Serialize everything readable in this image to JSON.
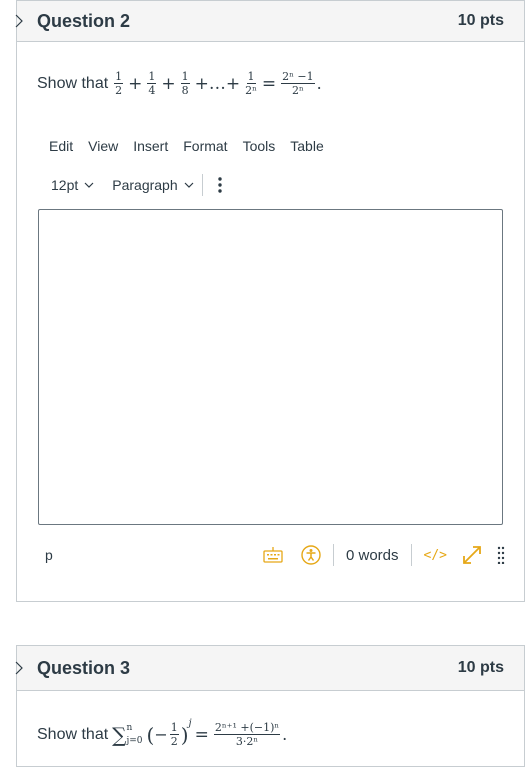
{
  "question2": {
    "title": "Question 2",
    "points": "10 pts",
    "prompt_prefix": "Show that",
    "math": {
      "t1_num": "1",
      "t1_den": "2",
      "t2_num": "1",
      "t2_den": "4",
      "t3_num": "1",
      "t3_den": "8",
      "ellipsis": "+…+",
      "tn_num": "1",
      "tn_den": "2ⁿ",
      "rhs_num": "2ⁿ −1",
      "rhs_den": "2ⁿ",
      "end": "."
    }
  },
  "editor": {
    "menu": [
      "Edit",
      "View",
      "Insert",
      "Format",
      "Tools",
      "Table"
    ],
    "font_size": "12pt",
    "block_format": "Paragraph",
    "path": "p",
    "word_count": "0 words",
    "html_toggle": "</>"
  },
  "question3": {
    "title": "Question 3",
    "points": "10 pts",
    "prompt_prefix": "Show that",
    "math": {
      "sum": "∑",
      "sum_upper": "n",
      "sum_lower": "j=0",
      "lparen": "(",
      "neg": "−",
      "f_num": "1",
      "f_den": "2",
      "rparen": ")",
      "exp": "j",
      "eq": "=",
      "rhs_num": "2ⁿ⁺¹ +(−1)ⁿ",
      "rhs_den": "3·2ⁿ",
      "end": "."
    }
  },
  "colors": {
    "accent": "#e6a817",
    "border": "#c7cdd1",
    "text": "#2d3b45",
    "header_bg": "#f5f5f5"
  }
}
